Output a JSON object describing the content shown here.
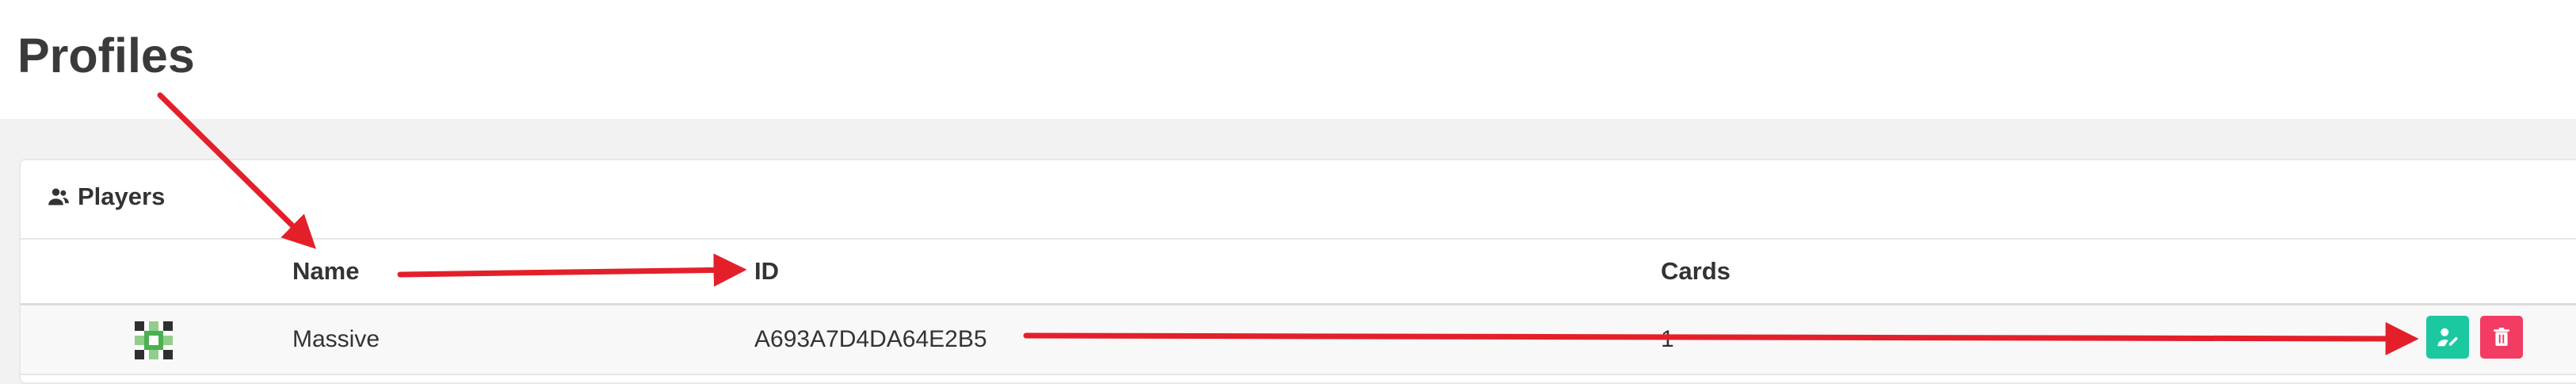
{
  "page": {
    "title": "Profiles"
  },
  "card": {
    "title": "Players",
    "icon": "players-icon"
  },
  "table": {
    "columns": [
      "Name",
      "ID",
      "Cards"
    ],
    "rows": [
      {
        "avatar_icon": "player-avatar",
        "name": "Massive",
        "id": "A693A7D4DA64E2B5",
        "cards": "1"
      }
    ]
  },
  "actions": {
    "edit_icon": "edit-user-icon",
    "delete_icon": "trash-icon"
  },
  "colors": {
    "accent_edit": "#1cc8a0",
    "accent_delete": "#f23c64",
    "annotation_arrow": "#e3202a"
  }
}
